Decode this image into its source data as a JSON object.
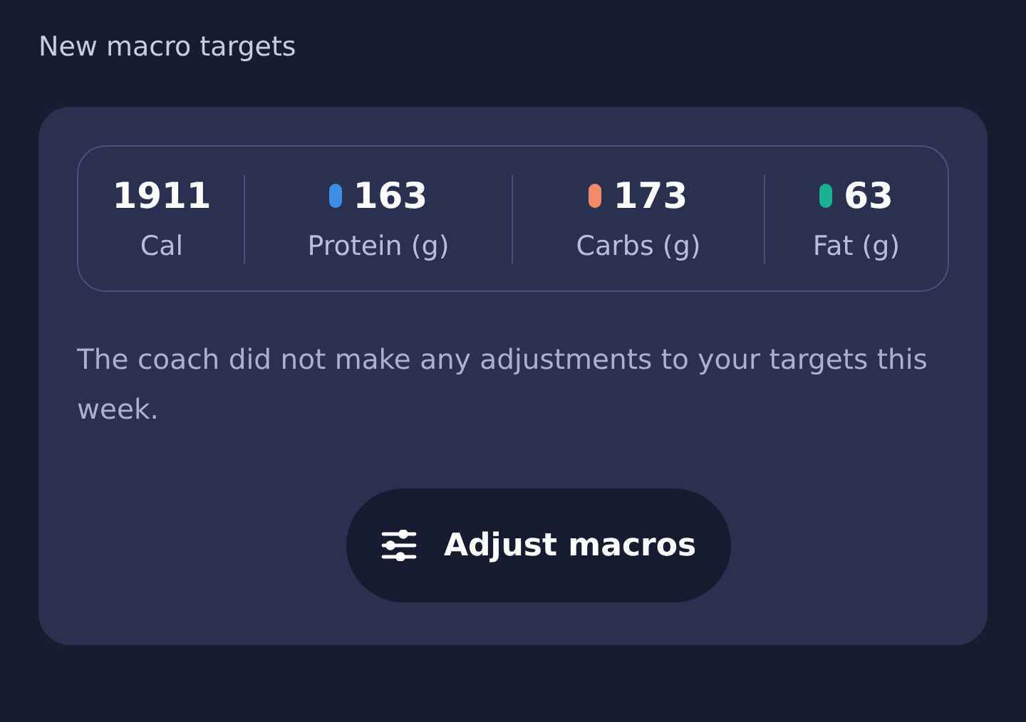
{
  "section_title": "New macro targets",
  "macros": [
    {
      "value": "1911",
      "label": "Cal"
    },
    {
      "value": "163",
      "label": "Protein (g)",
      "color": "#3d8ee6"
    },
    {
      "value": "173",
      "label": "Carbs (g)",
      "color": "#f08a6a"
    },
    {
      "value": "63",
      "label": "Fat (g)",
      "color": "#17b393"
    }
  ],
  "message": "The coach did not make any adjustments to your targets this week.",
  "button": {
    "label": "Adjust macros"
  }
}
